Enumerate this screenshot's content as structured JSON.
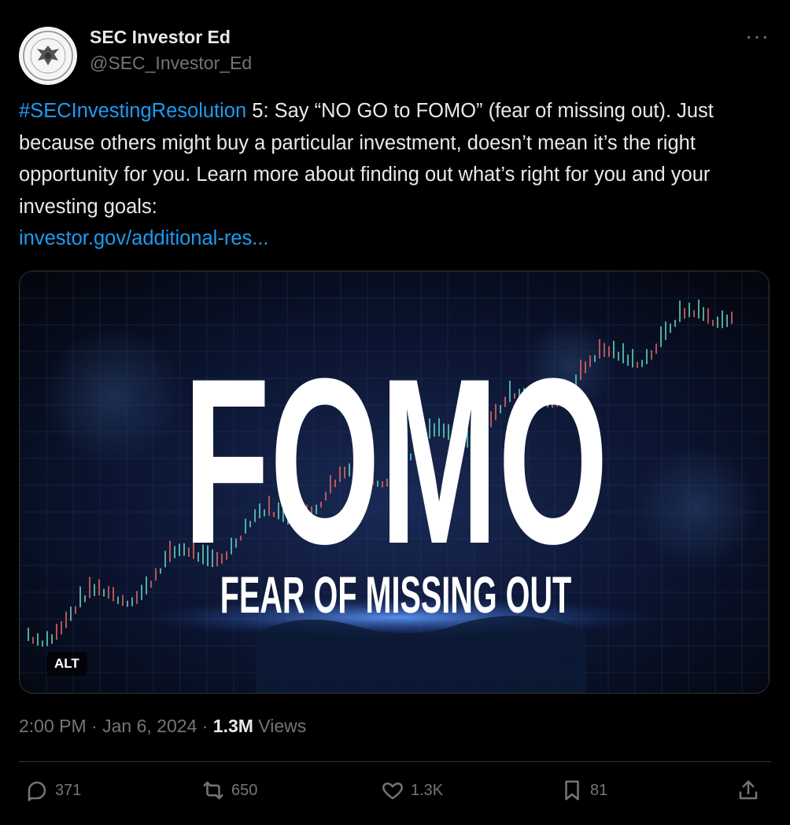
{
  "tweet": {
    "author_name": "SEC Investor Ed",
    "author_handle": "@SEC_Investor_Ed",
    "more_label": "···",
    "hashtag": "#SECInvestingResolution",
    "text": " 5: Say “NO GO to FOMO” (fear of missing out). Just because others might buy a particular investment, doesn’t mean it’s the right opportunity for you. Learn more about finding out what’s right for you and your investing goals:",
    "link": "investor.gov/additional-res...",
    "time": "2:00 PM",
    "separator": " · ",
    "date": "Jan 6, 2024",
    "views_count": "1.3M",
    "views_label": " Views"
  },
  "media": {
    "headline": "FOMO",
    "subheadline": "FEAR OF MISSING OUT",
    "alt_badge": "ALT"
  },
  "actions": {
    "replies": "371",
    "reposts": "650",
    "likes": "1.3K",
    "bookmarks": "81"
  },
  "icons": {
    "reply": "reply-icon",
    "repost": "repost-icon",
    "like": "heart-icon",
    "bookmark": "bookmark-icon",
    "share": "share-icon",
    "more": "more-horizontal-icon"
  },
  "colors": {
    "background": "#000000",
    "text": "#e7e9ea",
    "muted": "#71767b",
    "link": "#1d9bf0",
    "candle_up": "#5fd3bf",
    "candle_down": "#e0675f"
  }
}
